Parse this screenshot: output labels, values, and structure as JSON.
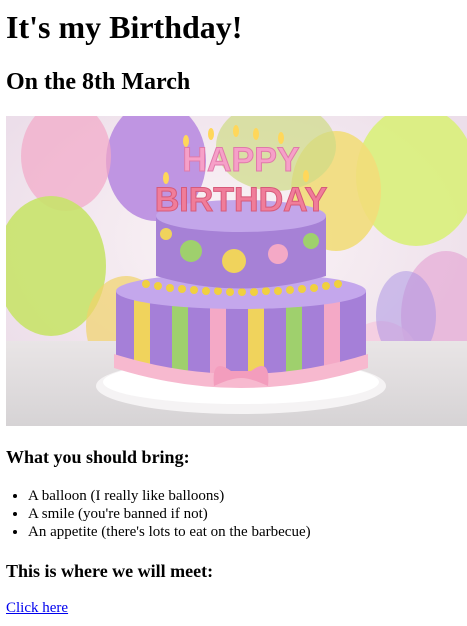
{
  "page": {
    "title": "It's my Birthday!",
    "subtitle": "On the 8th March"
  },
  "hero_image": {
    "icon": "birthday-cake-image",
    "alt": "birthday cake with HAPPY BIRTHDAY candles",
    "candle_text_top": "HAPPY",
    "candle_text_bottom": "BIRTHDAY"
  },
  "bring_section": {
    "heading": "What you should bring:",
    "items": [
      "A balloon (I really like balloons)",
      "A smile (you're banned if not)",
      "An appetite (there's lots to eat on the barbecue)"
    ]
  },
  "meet_section": {
    "heading": "This is where we will meet:",
    "link_label": "Click here"
  }
}
